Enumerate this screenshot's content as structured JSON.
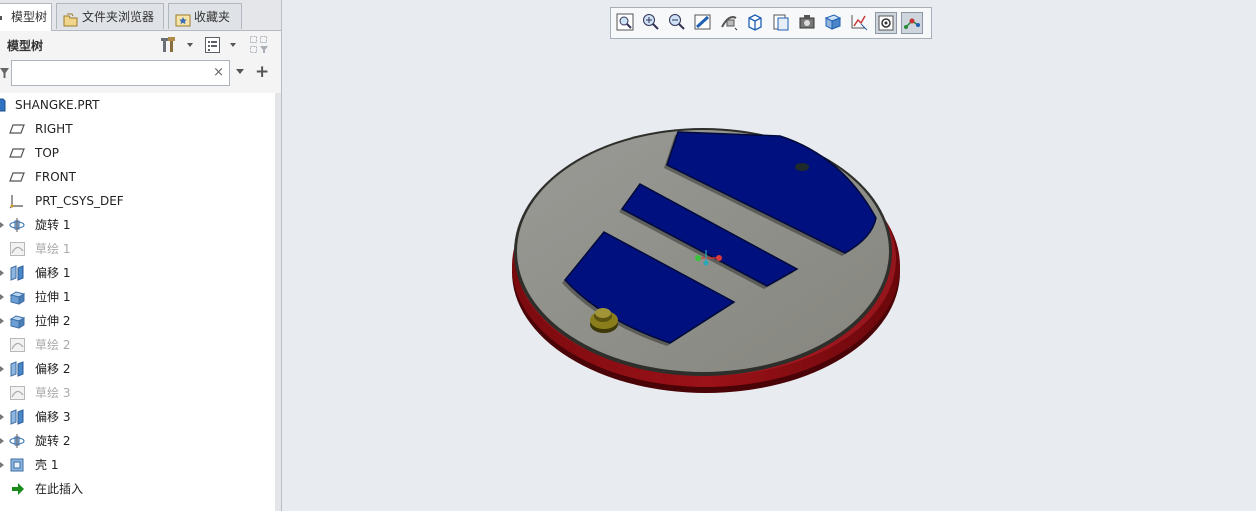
{
  "tabs": [
    {
      "label": "模型树",
      "active": true,
      "icon": "model-tree-icon"
    },
    {
      "label": "文件夹浏览器",
      "active": false,
      "icon": "folder-browser-icon"
    },
    {
      "label": "收藏夹",
      "active": false,
      "icon": "favorites-icon"
    }
  ],
  "panel": {
    "title": "模型树",
    "settings_icon": "tree-settings-icon",
    "show_icon": "tree-show-icon",
    "filter_icon": "tree-filter-icon"
  },
  "search": {
    "value": "",
    "placeholder": "",
    "clear_glyph": "×",
    "add_glyph": "+"
  },
  "tree": [
    {
      "label": "SHANGKE.PRT",
      "icon": "part-icon",
      "expandable": false,
      "suppressed": false
    },
    {
      "label": "RIGHT",
      "icon": "datum-plane-icon",
      "expandable": false,
      "suppressed": false
    },
    {
      "label": "TOP",
      "icon": "datum-plane-icon",
      "expandable": false,
      "suppressed": false
    },
    {
      "label": "FRONT",
      "icon": "datum-plane-icon",
      "expandable": false,
      "suppressed": false
    },
    {
      "label": "PRT_CSYS_DEF",
      "icon": "csys-icon",
      "expandable": false,
      "suppressed": false
    },
    {
      "label": "旋转 1",
      "icon": "revolve-icon",
      "expandable": true,
      "suppressed": false
    },
    {
      "label": "草绘 1",
      "icon": "sketch-icon",
      "expandable": false,
      "suppressed": true
    },
    {
      "label": "偏移 1",
      "icon": "offset-icon",
      "expandable": true,
      "suppressed": false
    },
    {
      "label": "拉伸 1",
      "icon": "extrude-icon",
      "expandable": true,
      "suppressed": false
    },
    {
      "label": "拉伸 2",
      "icon": "extrude-icon",
      "expandable": true,
      "suppressed": false
    },
    {
      "label": "草绘 2",
      "icon": "sketch-icon",
      "expandable": false,
      "suppressed": true
    },
    {
      "label": "偏移 2",
      "icon": "offset-icon",
      "expandable": true,
      "suppressed": false
    },
    {
      "label": "草绘 3",
      "icon": "sketch-icon",
      "expandable": false,
      "suppressed": true
    },
    {
      "label": "偏移 3",
      "icon": "offset-icon",
      "expandable": true,
      "suppressed": false
    },
    {
      "label": "旋转 2",
      "icon": "revolve-icon",
      "expandable": true,
      "suppressed": false
    },
    {
      "label": "壳 1",
      "icon": "shell-icon",
      "expandable": true,
      "suppressed": false
    },
    {
      "label": "在此插入",
      "icon": "insert-here-arrow-icon",
      "expandable": false,
      "suppressed": false
    }
  ],
  "view_toolbar": [
    {
      "icon": "refit-icon",
      "pressed": false
    },
    {
      "icon": "zoom-in-icon",
      "pressed": false
    },
    {
      "icon": "zoom-out-icon",
      "pressed": false
    },
    {
      "icon": "repaint-icon",
      "pressed": false
    },
    {
      "icon": "reorient-icon",
      "pressed": false
    },
    {
      "icon": "saved-orientations-icon",
      "pressed": false
    },
    {
      "icon": "display-style-icon",
      "pressed": false
    },
    {
      "icon": "view-manager-icon",
      "pressed": false
    },
    {
      "icon": "perspective-view-icon",
      "pressed": false
    },
    {
      "icon": "datum-display-filters-icon",
      "pressed": false
    },
    {
      "icon": "annotation-display-icon",
      "pressed": true
    },
    {
      "icon": "spin-center-icon",
      "pressed": true
    }
  ],
  "colors": {
    "face_gray": "#8e8e8a",
    "rim_red": "#8b0a10",
    "pocket_blue": "#00107e",
    "boss_yellow": "#6f6616",
    "panel_bg": "#f4f4f4",
    "viewport_bg": "#e8ebef"
  }
}
